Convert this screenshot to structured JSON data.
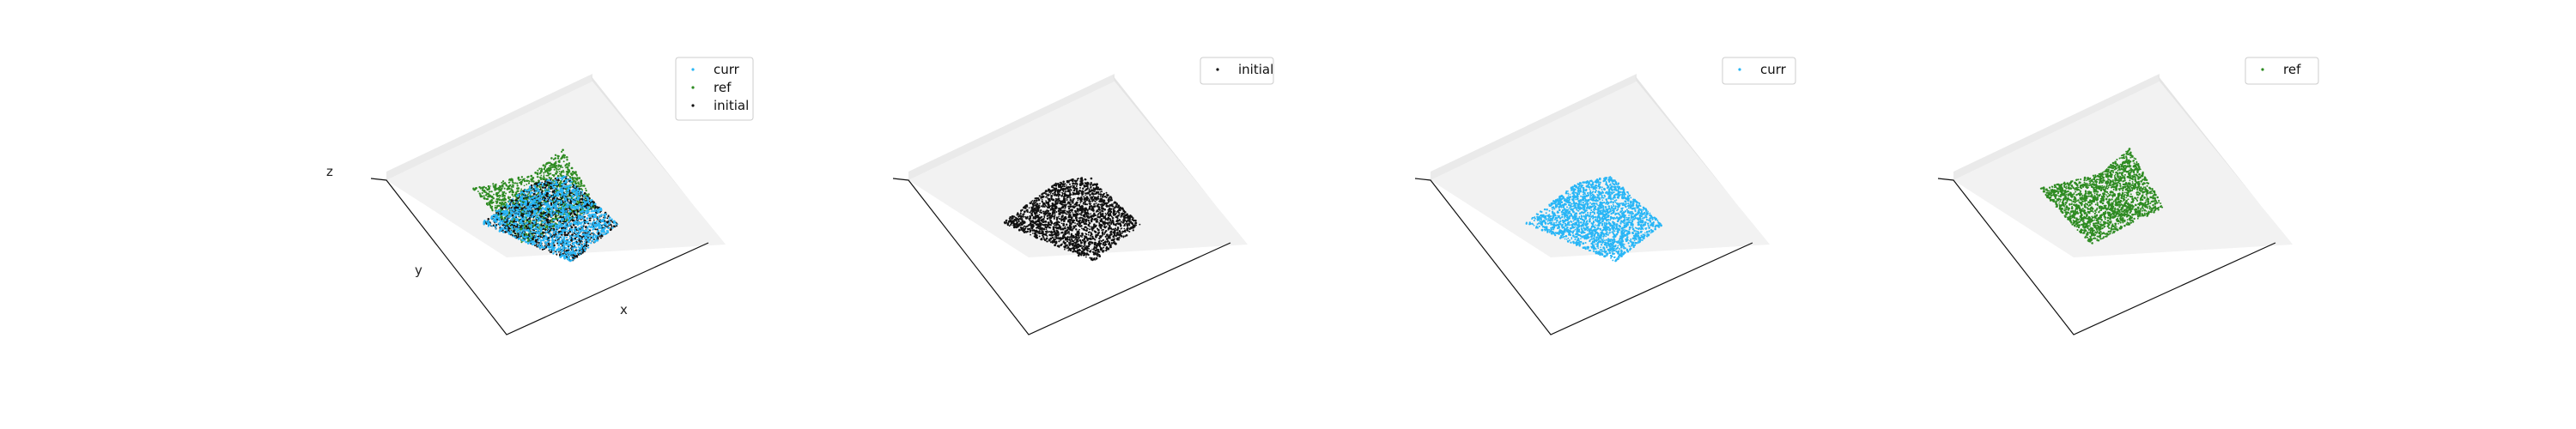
{
  "chart_data": [
    {
      "type": "scatter",
      "subtype": "3d-point-cloud",
      "axis_labels": {
        "x": "x",
        "y": "y",
        "z": "z"
      },
      "show_axis_labels": true,
      "legend_location": "upper-right",
      "series": [
        {
          "name": "curr",
          "color": "#29b6f6"
        },
        {
          "name": "ref",
          "color": "#2e8b22"
        },
        {
          "name": "initial",
          "color": "#111111"
        }
      ]
    },
    {
      "type": "scatter",
      "subtype": "3d-point-cloud",
      "show_axis_labels": false,
      "legend_location": "upper-right",
      "series": [
        {
          "name": "initial",
          "color": "#111111"
        }
      ]
    },
    {
      "type": "scatter",
      "subtype": "3d-point-cloud",
      "show_axis_labels": false,
      "legend_location": "upper-right",
      "series": [
        {
          "name": "curr",
          "color": "#29b6f6"
        }
      ]
    },
    {
      "type": "scatter",
      "subtype": "3d-point-cloud",
      "show_axis_labels": false,
      "legend_location": "upper-right",
      "series": [
        {
          "name": "ref",
          "color": "#2e8b22"
        }
      ]
    }
  ]
}
